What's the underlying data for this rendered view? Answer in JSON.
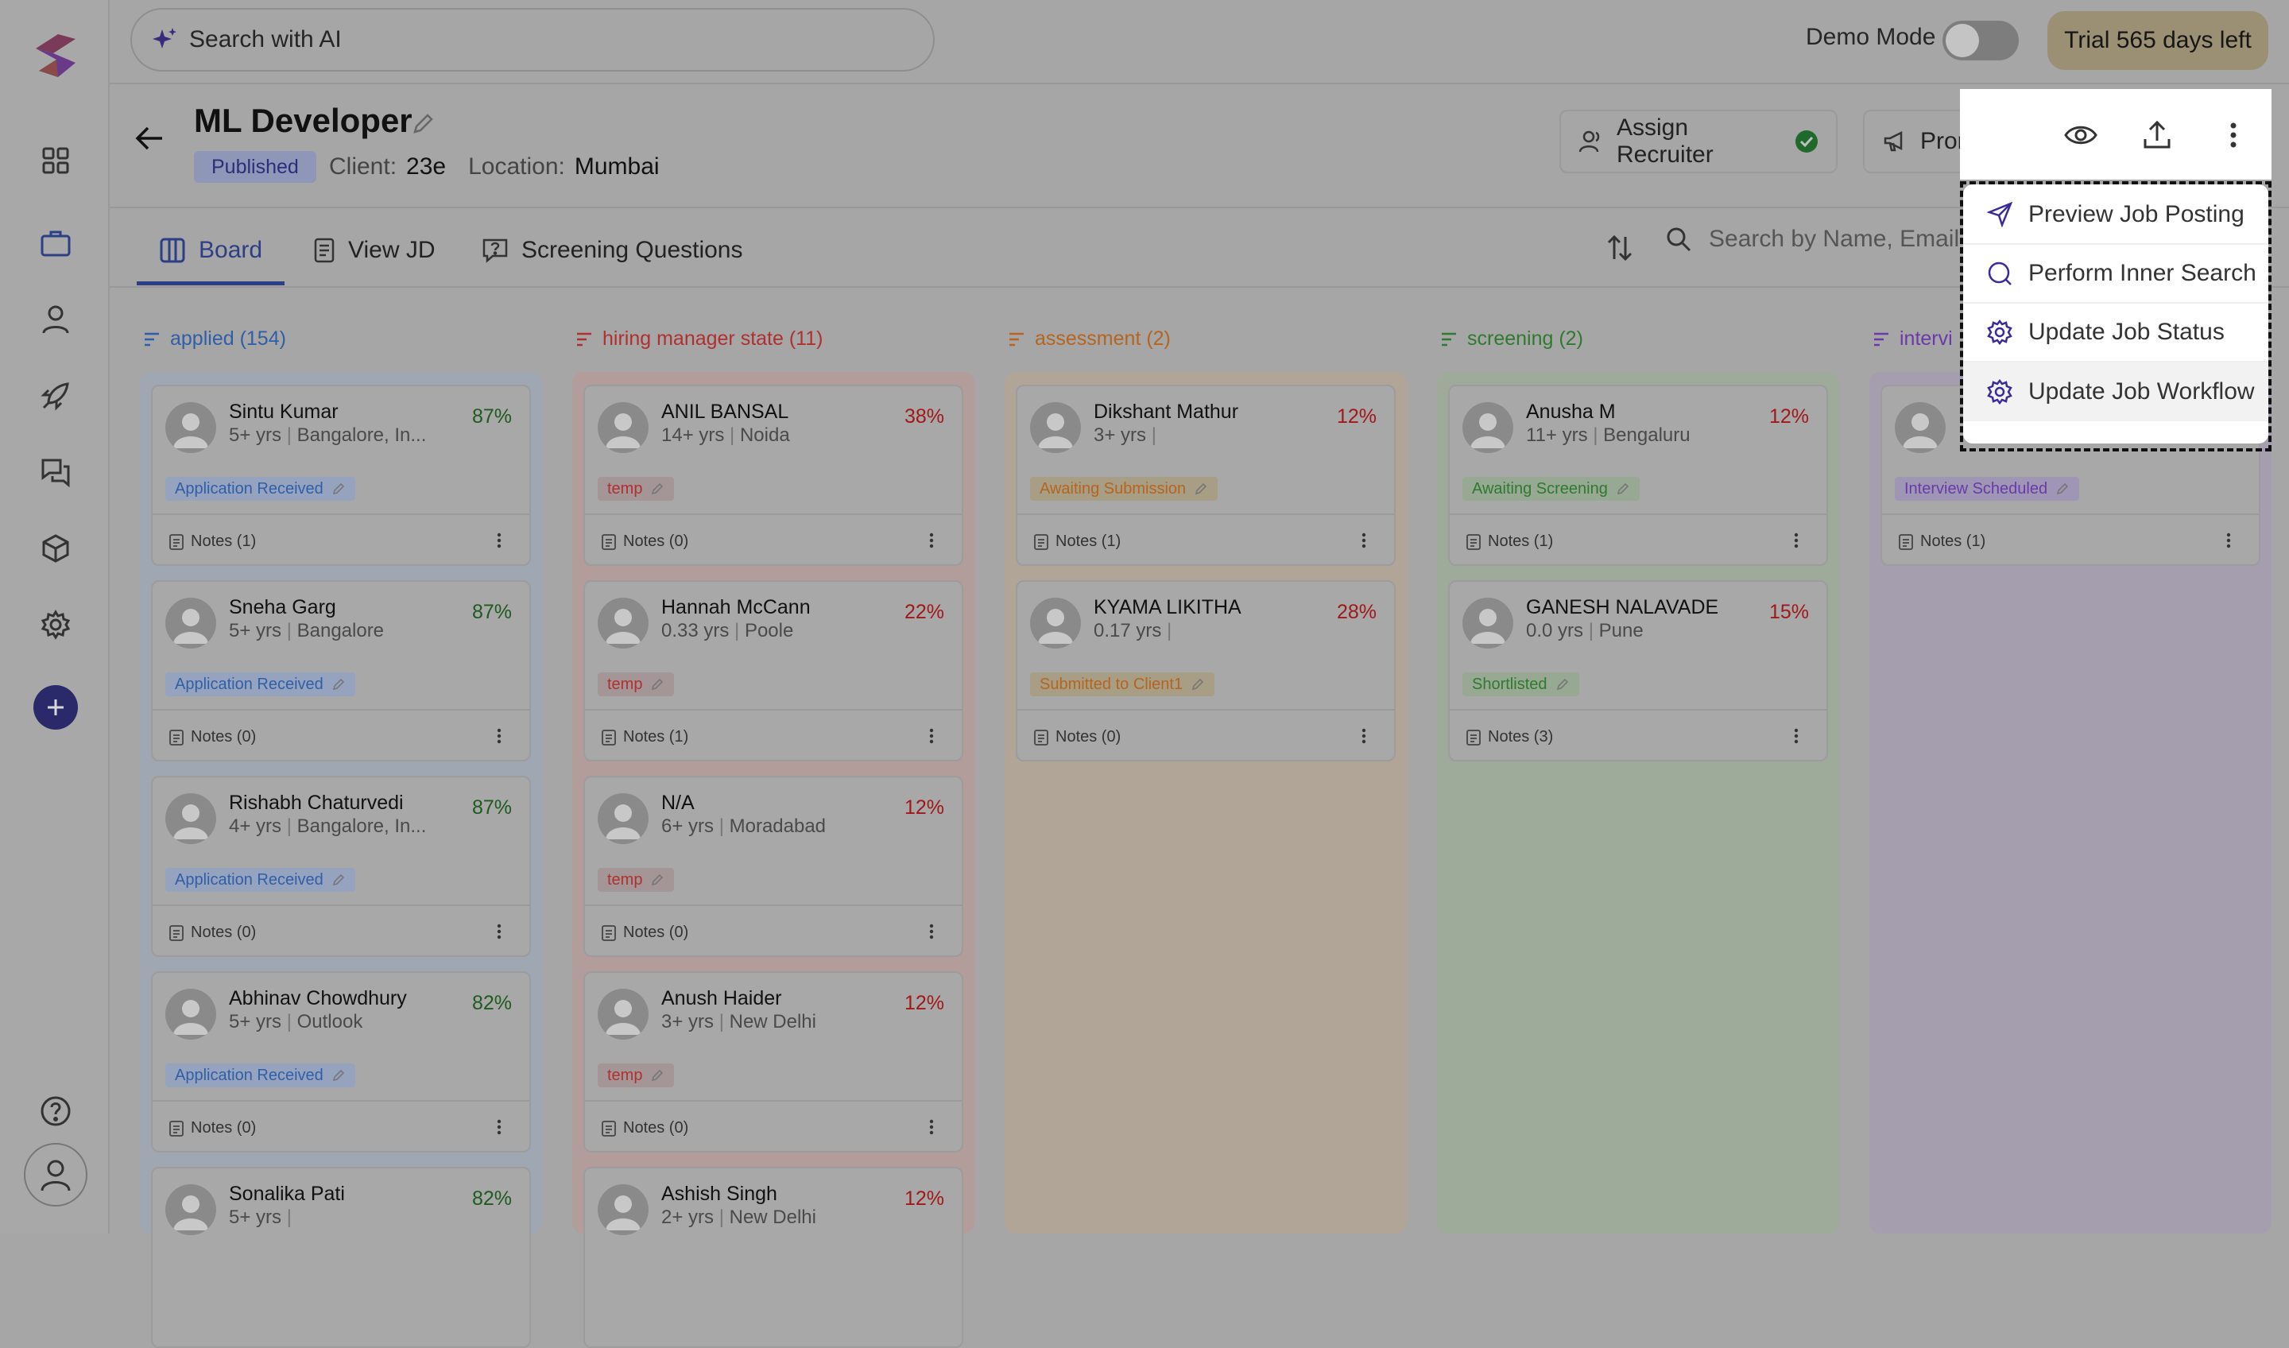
{
  "topbar": {
    "search_placeholder": "Search with AI",
    "demo_mode_label": "Demo Mode",
    "trial_label": "Trial 565 days left"
  },
  "job": {
    "title": "ML Developer",
    "status": "Published",
    "client_label": "Client:",
    "client_value": "23e",
    "location_label": "Location:",
    "location_value": "Mumbai"
  },
  "actions": {
    "assign_recruiter": "Assign Recruiter",
    "promote": "Promote"
  },
  "tabs": [
    {
      "label": "Board",
      "icon": "board-icon",
      "active": true
    },
    {
      "label": "View JD",
      "icon": "document-icon",
      "active": false
    },
    {
      "label": "Screening Questions",
      "icon": "question-icon",
      "active": false
    }
  ],
  "search": {
    "placeholder": "Search by Name, Email o"
  },
  "menu": {
    "items": [
      {
        "label": "Preview Job Posting",
        "icon": "send-icon"
      },
      {
        "label": "Perform Inner Search",
        "icon": "search-icon"
      },
      {
        "label": "Update Job Status",
        "icon": "gear-icon"
      },
      {
        "label": "Update Job Workflow",
        "icon": "gear-icon"
      }
    ]
  },
  "colors": {
    "applied": "#2f5fa8",
    "hiring": "#b03030",
    "assessment": "#b5651d",
    "screening": "#2f7a2f",
    "interview": "#6a3aa8"
  },
  "columns": [
    {
      "title": "applied (154)",
      "cards": [
        {
          "name": "Sintu Kumar",
          "exp": "5+ yrs",
          "loc": "Bangalore, In...",
          "pct": "87%",
          "status": "Application Received",
          "notes": "Notes (1)"
        },
        {
          "name": "Sneha Garg",
          "exp": "5+ yrs",
          "loc": "Bangalore",
          "pct": "87%",
          "status": "Application Received",
          "notes": "Notes (0)"
        },
        {
          "name": "Rishabh Chaturvedi",
          "exp": "4+ yrs",
          "loc": "Bangalore, In...",
          "pct": "87%",
          "status": "Application Received",
          "notes": "Notes (0)"
        },
        {
          "name": "Abhinav Chowdhury",
          "exp": "5+ yrs",
          "loc": "Outlook",
          "pct": "82%",
          "status": "Application Received",
          "notes": "Notes (0)"
        },
        {
          "name": "Sonalika Pati",
          "exp": "5+ yrs",
          "loc": "",
          "pct": "82%",
          "status": "",
          "notes": ""
        }
      ]
    },
    {
      "title": "hiring manager state (11)",
      "cards": [
        {
          "name": "ANIL BANSAL",
          "exp": "14+ yrs",
          "loc": "Noida",
          "pct": "38%",
          "status": "temp",
          "notes": "Notes (0)"
        },
        {
          "name": "Hannah McCann",
          "exp": "0.33 yrs",
          "loc": "Poole",
          "pct": "22%",
          "status": "temp",
          "notes": "Notes (1)"
        },
        {
          "name": "N/A",
          "exp": "6+ yrs",
          "loc": "Moradabad",
          "pct": "12%",
          "status": "temp",
          "notes": "Notes (0)"
        },
        {
          "name": "Anush Haider",
          "exp": "3+ yrs",
          "loc": "New Delhi",
          "pct": "12%",
          "status": "temp",
          "notes": "Notes (0)"
        },
        {
          "name": "Ashish Singh",
          "exp": "2+ yrs",
          "loc": "New Delhi",
          "pct": "12%",
          "status": "",
          "notes": ""
        }
      ]
    },
    {
      "title": "assessment (2)",
      "cards": [
        {
          "name": "Dikshant Mathur",
          "exp": "3+ yrs",
          "loc": "",
          "pct": "12%",
          "status": "Awaiting Submission",
          "notes": "Notes (1)"
        },
        {
          "name": "KYAMA LIKITHA",
          "exp": "0.17 yrs",
          "loc": "",
          "pct": "28%",
          "status": "Submitted to Client1",
          "notes": "Notes (0)"
        }
      ]
    },
    {
      "title": "screening (2)",
      "cards": [
        {
          "name": "Anusha M",
          "exp": "11+ yrs",
          "loc": "Bengaluru",
          "pct": "12%",
          "status": "Awaiting Screening",
          "notes": "Notes (1)"
        },
        {
          "name": "GANESH NALAVADE",
          "exp": "0.0 yrs",
          "loc": "Pune",
          "pct": "15%",
          "status": "Shortlisted",
          "notes": "Notes (3)"
        }
      ]
    },
    {
      "title": "intervi",
      "cards": [
        {
          "name": "",
          "exp": "",
          "loc": "",
          "pct": "",
          "status": "Interview Scheduled",
          "notes": "Notes (1)"
        }
      ]
    }
  ]
}
